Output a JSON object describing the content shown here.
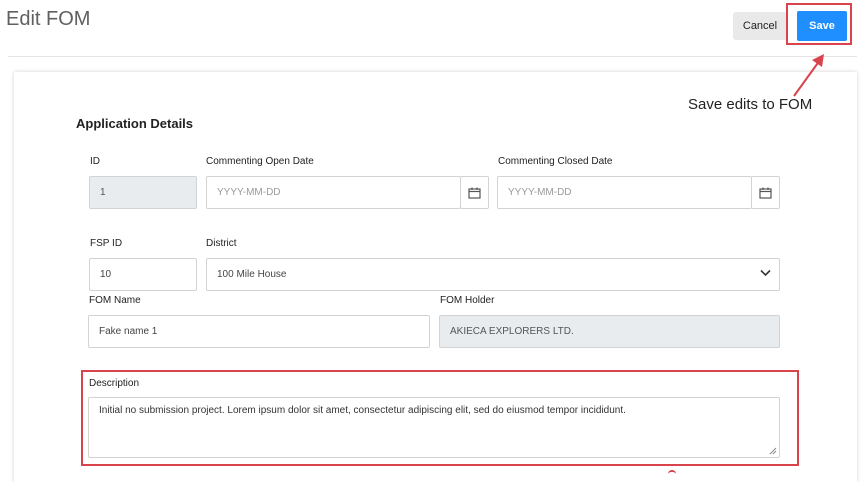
{
  "header": {
    "title": "Edit FOM",
    "cancel_label": "Cancel",
    "save_label": "Save"
  },
  "annotations": {
    "save_callout": "Save edits to FOM",
    "highlight_color": "#d9434b"
  },
  "form": {
    "section_title": "Application Details",
    "id": {
      "label": "ID",
      "value": "1"
    },
    "commenting_open_date": {
      "label": "Commenting Open Date",
      "placeholder": "YYYY-MM-DD"
    },
    "commenting_closed_date": {
      "label": "Commenting Closed Date",
      "placeholder": "YYYY-MM-DD"
    },
    "fsp_id": {
      "label": "FSP ID",
      "value": "10"
    },
    "district": {
      "label": "District",
      "value": "100 Mile House"
    },
    "fom_name": {
      "label": "FOM Name",
      "value": "Fake name 1"
    },
    "fom_holder": {
      "label": "FOM Holder",
      "value": "AKIECA EXPLORERS LTD."
    },
    "description": {
      "label": "Description",
      "value": "Initial no submission project. Lorem ipsum dolor sit amet, consectetur adipiscing elit, sed do eiusmod tempor incididunt."
    }
  },
  "icons": {
    "calendar": "calendar-icon",
    "dropdown": "chevron-down-icon",
    "arrow": "arrow-icon",
    "resize": "resize-grip-icon"
  },
  "colors": {
    "primary": "#1f8fff",
    "disabled_bg": "#e9ecef"
  }
}
